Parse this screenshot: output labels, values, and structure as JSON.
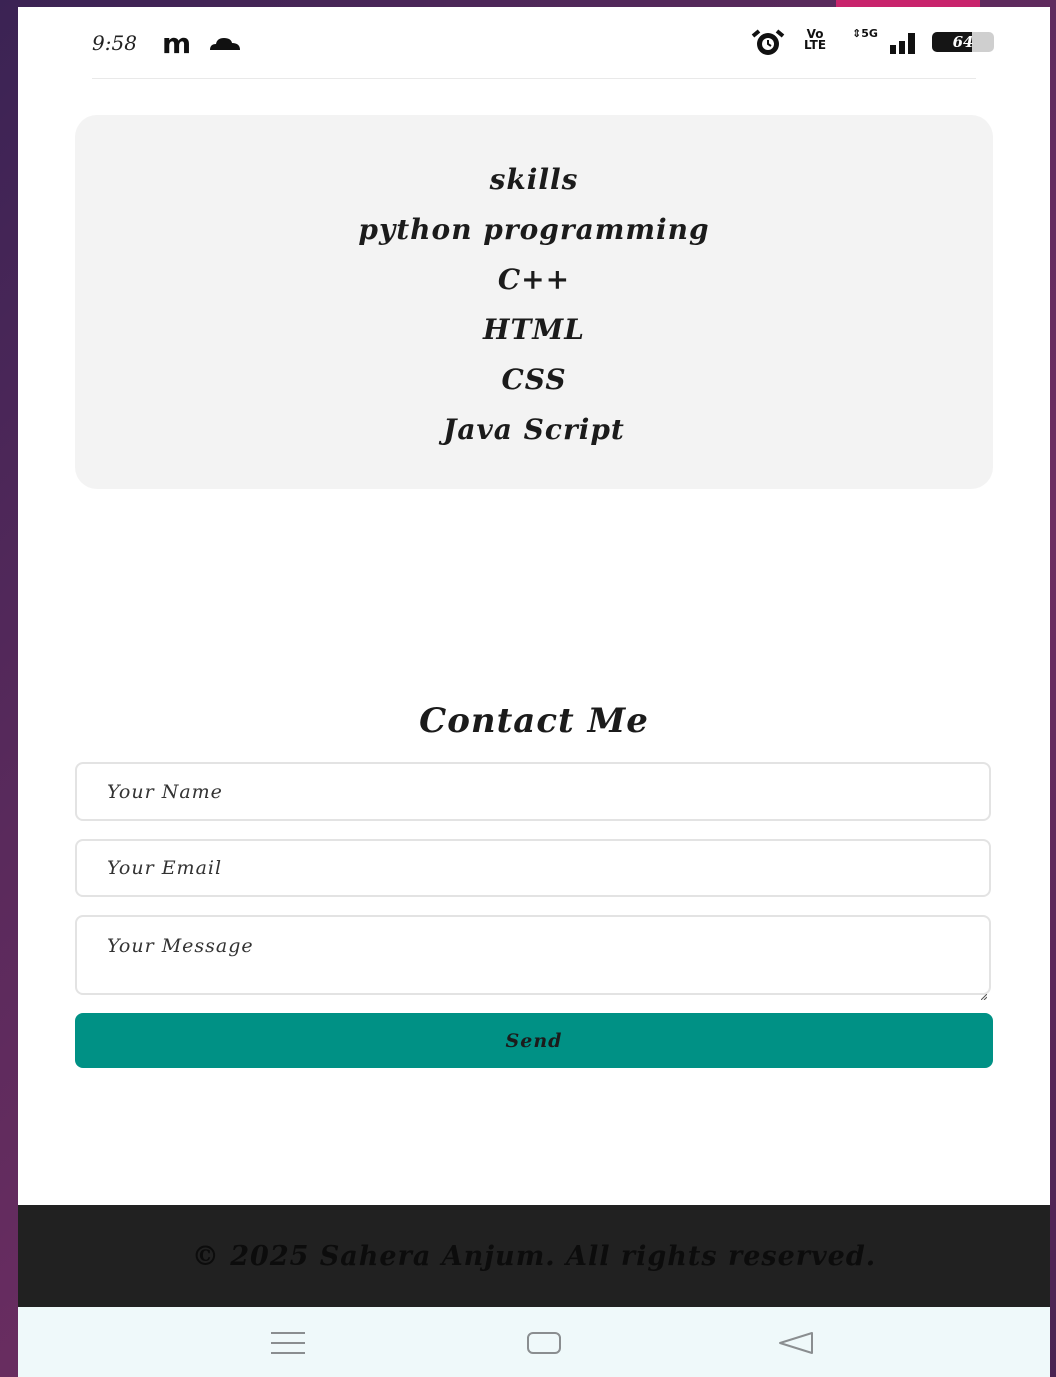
{
  "status_bar": {
    "time": "9:58",
    "app_glyph": "m",
    "volte_top": "Vo",
    "volte_bottom": "LTE",
    "network": "5G",
    "battery_level": 64,
    "battery_text": "64"
  },
  "skills": {
    "title": "skills",
    "items": [
      "python programming",
      "C++",
      "HTML",
      "CSS",
      "Java Script"
    ]
  },
  "contact": {
    "title": "Contact Me",
    "name_placeholder": "Your Name",
    "email_placeholder": "Your Email",
    "message_placeholder": "Your Message",
    "send_label": "Send"
  },
  "footer": {
    "text": "© 2025 Sahera Anjum. All rights reserved."
  },
  "colors": {
    "button": "#009185",
    "footer": "#212121",
    "card": "#f3f3f3",
    "nav": "#eff9fa"
  },
  "icons": {
    "cloud": "cloud-icon",
    "alarm": "alarm-icon",
    "signal": "signal-icon",
    "battery": "battery-icon",
    "nav_menu": "menu-icon",
    "nav_home": "home-icon",
    "nav_back": "back-icon"
  }
}
